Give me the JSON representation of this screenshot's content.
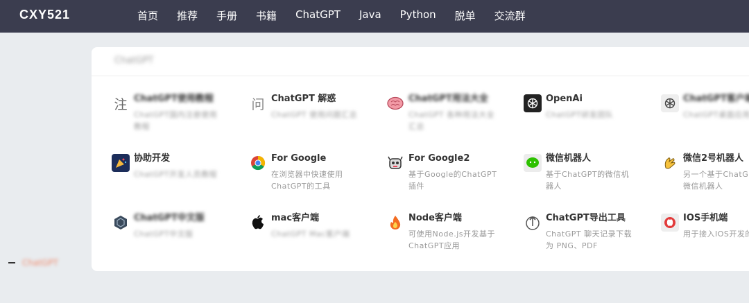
{
  "navbar": {
    "brand": "CXY521",
    "items": [
      "首页",
      "推荐",
      "手册",
      "书籍",
      "ChatGPT",
      "Java",
      "Python",
      "脱单",
      "交流群"
    ]
  },
  "card": {
    "title": "ChatGPT",
    "items": [
      {
        "title": "ChatGPT使用教程",
        "desc": "ChatGPT国内注册使用教程",
        "icon": "注"
      },
      {
        "title": "ChatGPT 解惑",
        "desc": "ChatGPT 使用问题汇总",
        "icon": "问"
      },
      {
        "title": "ChatGPT用法大全",
        "desc": "ChatGPT 各种用法大全汇总",
        "icon": "brain-icon"
      },
      {
        "title": "OpenAi",
        "desc": "ChatGPT研发团队",
        "icon": "openai-icon"
      },
      {
        "title": "ChatGPT客户端",
        "desc": "ChatGPT桌面应用",
        "icon": "openai-icon"
      },
      {
        "title": "协助开发",
        "desc": "ChatGPT开发人员教程",
        "icon": "party-icon"
      },
      {
        "title": "For Google",
        "desc": "在浏览器中快速使用ChatGPT的工具",
        "icon": "chrome-icon"
      },
      {
        "title": "For Google2",
        "desc": "基于Google的ChatGPT插件",
        "icon": "robot-icon"
      },
      {
        "title": "微信机器人",
        "desc": "基于ChatGPT的微信机器人",
        "icon": "wechat-icon"
      },
      {
        "title": "微信2号机器人",
        "desc": "另一个基于ChatGPT的微信机器人",
        "icon": "clap-icon"
      },
      {
        "title": "ChatGPT中文版",
        "desc": "ChatGPT中文版",
        "icon": "hex-icon"
      },
      {
        "title": "mac客户端",
        "desc": "ChatGPT Mac客户端",
        "icon": "apple-icon"
      },
      {
        "title": "Node客户端",
        "desc": "可使用Node.js开发基于ChatGPT应用",
        "icon": "fire-icon"
      },
      {
        "title": "ChatGPT导出工具",
        "desc": "ChatGPT 聊天记录下载为 PNG、PDF",
        "icon": "export-icon"
      },
      {
        "title": "IOS手机端",
        "desc": "用于接入IOS开发的",
        "icon": "ios-icon"
      }
    ]
  },
  "sidebar": {
    "link": "ChatGPT"
  },
  "colors": {
    "navbar_bg": "#3b3d4f",
    "accent": "#f08a6c"
  }
}
